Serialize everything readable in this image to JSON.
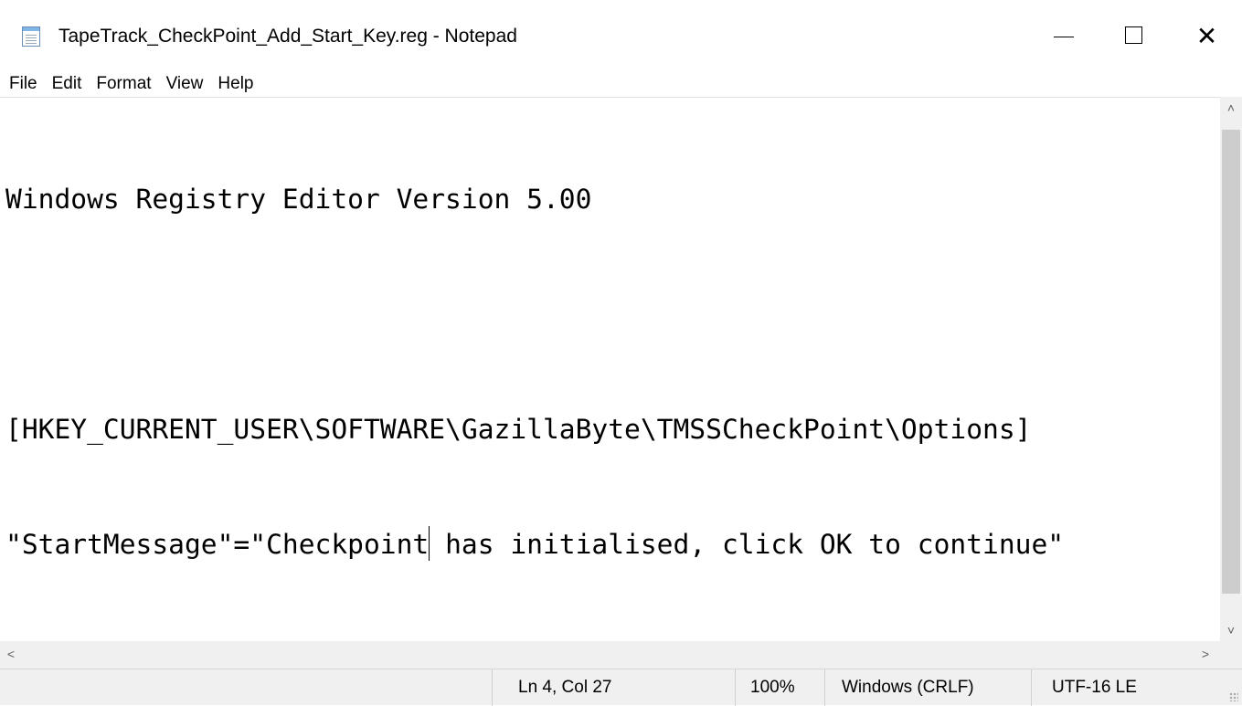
{
  "window": {
    "title": "TapeTrack_CheckPoint_Add_Start_Key.reg - Notepad",
    "icon": "notepad-icon",
    "controls": {
      "minimize": "—",
      "maximize": "□",
      "close": "✕"
    }
  },
  "menu": {
    "items": [
      {
        "label": "File"
      },
      {
        "label": "Edit"
      },
      {
        "label": "Format"
      },
      {
        "label": "View"
      },
      {
        "label": "Help"
      }
    ]
  },
  "editor": {
    "lines": [
      "Windows Registry Editor Version 5.00",
      "",
      "[HKEY_CURRENT_USER\\SOFTWARE\\GazillaByte\\TMSSCheckPoint\\Options]",
      "\"StartMessage\"=\"Checkpoint has initialised, click OK to continue\""
    ],
    "caret_line_before": "\"StartMessage\"=\"Checkpoint",
    "caret_line_after": " has initialised, click OK to continue\""
  },
  "scrollbars": {
    "up_glyph": "˄",
    "down_glyph": "˅",
    "left_glyph": "<",
    "right_glyph": ">"
  },
  "status": {
    "position": "Ln 4, Col 27",
    "zoom": "100%",
    "line_ending": "Windows (CRLF)",
    "encoding": "UTF-16 LE"
  }
}
